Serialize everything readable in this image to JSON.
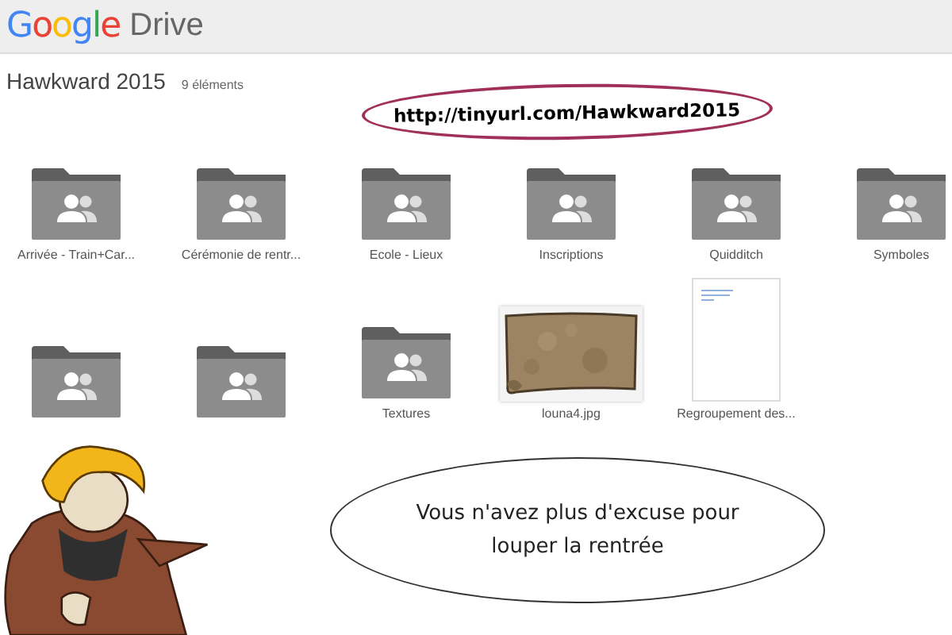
{
  "header": {
    "logo": "Google",
    "product": "Drive"
  },
  "folder": {
    "title": "Hawkward 2015",
    "count": "9 éléments"
  },
  "annotation": {
    "url": "http://tinyurl.com/Hawkward2015"
  },
  "items": [
    {
      "kind": "folder",
      "label": "Arrivée - Train+Car..."
    },
    {
      "kind": "folder",
      "label": "Cérémonie de rentr..."
    },
    {
      "kind": "folder",
      "label": "Ecole - Lieux"
    },
    {
      "kind": "folder",
      "label": "Inscriptions"
    },
    {
      "kind": "folder",
      "label": "Quidditch"
    },
    {
      "kind": "folder",
      "label": "Symboles"
    },
    {
      "kind": "folder"
    },
    {
      "kind": "folder"
    },
    {
      "kind": "folder",
      "label": "Textures"
    },
    {
      "label": "louna4.jpg"
    },
    {
      "kind": "document",
      "label": "Regroupement des..."
    }
  ],
  "speech_bubble": {
    "lines": [
      "Vous n'avez plus d'excuse pour",
      "louper la rentrée"
    ]
  }
}
